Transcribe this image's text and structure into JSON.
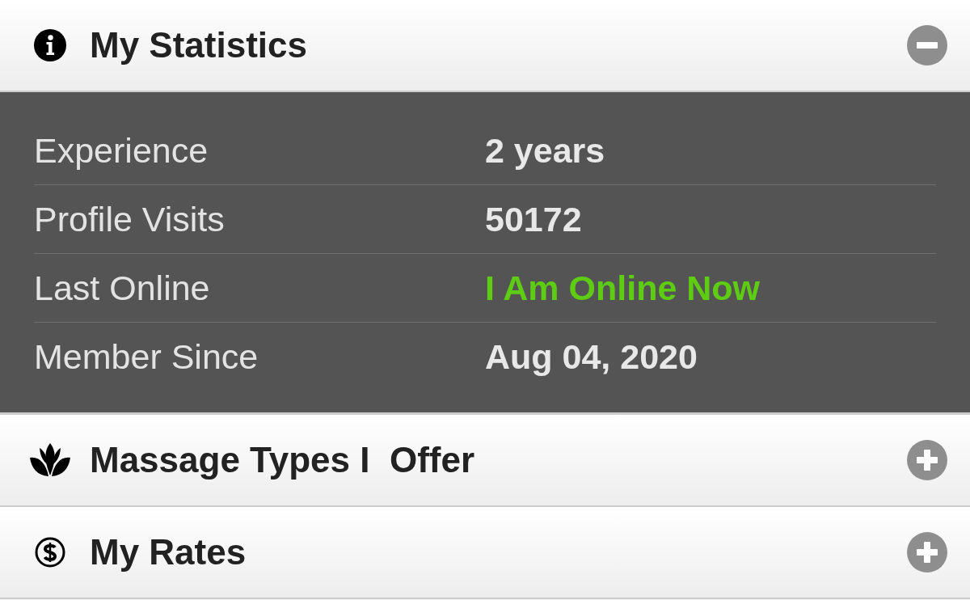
{
  "sections": [
    {
      "kind": "stats",
      "title": "My Statistics",
      "expanded": true,
      "rows": [
        {
          "label": "Experience",
          "value": "2 years",
          "color": "#e8e8e8"
        },
        {
          "label": "Profile Visits",
          "value": "50172",
          "color": "#e8e8e8"
        },
        {
          "label": "Last Online",
          "value": "I Am Online Now",
          "color": "#5dcc12"
        },
        {
          "label": "Member Since",
          "value": "Aug 04, 2020",
          "color": "#e8e8e8"
        }
      ]
    },
    {
      "kind": "services",
      "title": "Massage Types I  Offer",
      "expanded": false
    },
    {
      "kind": "rates",
      "title": "My Rates",
      "expanded": false
    }
  ]
}
